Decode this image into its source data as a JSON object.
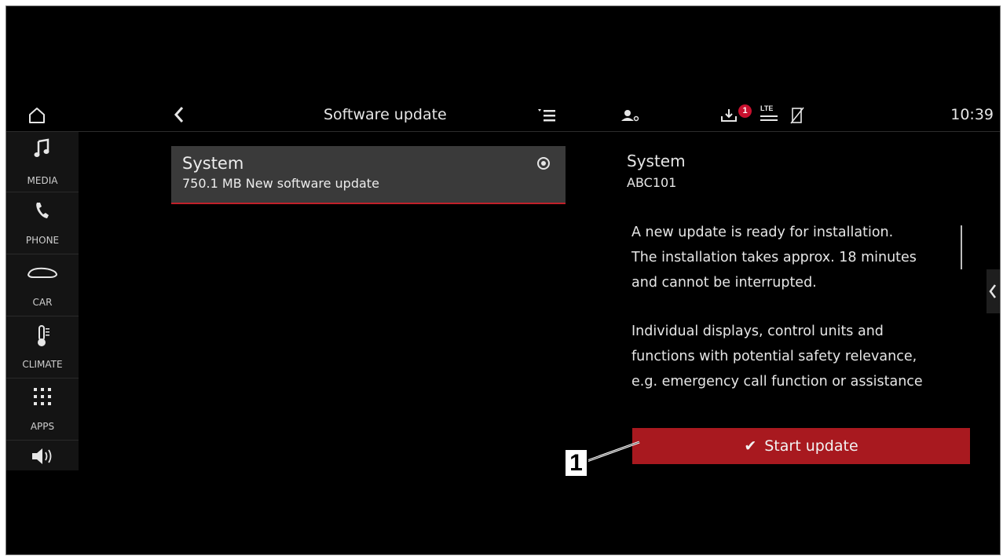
{
  "topbar": {
    "title": "Software update",
    "clock": "10:39",
    "notification_count": "1",
    "network_label": "LTE"
  },
  "sidebar": {
    "items": [
      {
        "label": "MEDIA",
        "icon": "music-note-icon"
      },
      {
        "label": "PHONE",
        "icon": "phone-icon"
      },
      {
        "label": "CAR",
        "icon": "car-icon"
      },
      {
        "label": "CLIMATE",
        "icon": "thermometer-icon"
      },
      {
        "label": "APPS",
        "icon": "apps-grid-icon"
      },
      {
        "label": "",
        "icon": "volume-icon"
      }
    ]
  },
  "update_list": {
    "items": [
      {
        "title": "System",
        "subtitle": "750.1 MB New software update",
        "selected": true
      }
    ]
  },
  "detail": {
    "title": "System",
    "version": "ABC101",
    "paragraph1": [
      "A new update is ready for installation.",
      "The installation takes approx. 18 minutes",
      "and cannot be interrupted."
    ],
    "paragraph2": [
      "Individual displays, control units and",
      "functions with potential safety relevance,",
      "e.g. emergency call function or assistance"
    ],
    "start_button_label": "Start update"
  },
  "callout": {
    "label": "1"
  },
  "colors": {
    "accent_red": "#a8191f",
    "badge_red": "#c8102e",
    "card_bg": "#3a3a3a"
  }
}
